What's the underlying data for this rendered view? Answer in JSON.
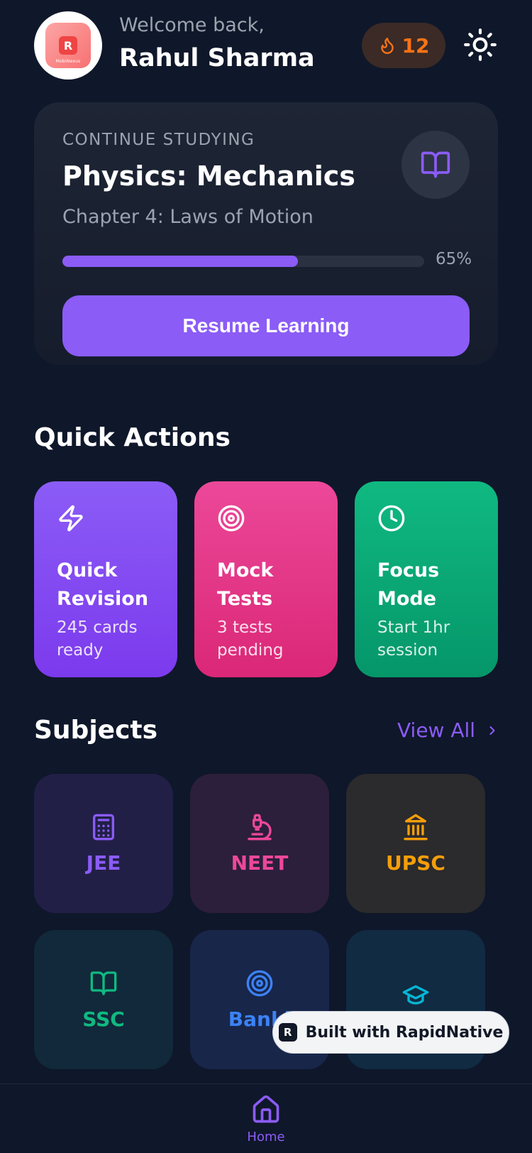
{
  "header": {
    "avatar_caption": "MobiNexus",
    "welcome": "Welcome back,",
    "name": "Rahul Sharma",
    "streak_count": "12",
    "streak_icon": "flame-icon",
    "theme_icon": "sun-icon"
  },
  "continue": {
    "kicker": "CONTINUE STUDYING",
    "title": "Physics: Mechanics",
    "chapter": "Chapter 4: Laws of Motion",
    "progress": 65,
    "progress_label": "65%",
    "button": "Resume Learning",
    "icon": "book-open-icon"
  },
  "quick_actions": {
    "title": "Quick Actions",
    "items": [
      {
        "label": "Quick Revision",
        "desc": "245 cards ready",
        "icon": "zap-icon",
        "color": "#8b5cf6"
      },
      {
        "label": "Mock Tests",
        "desc": "3 tests pending",
        "icon": "target-icon",
        "color": "#ec4899"
      },
      {
        "label": "Focus Mode",
        "desc": "Start 1hr session",
        "icon": "clock-icon",
        "color": "#10b981"
      }
    ]
  },
  "subjects": {
    "title": "Subjects",
    "view_all": "View All",
    "items": [
      {
        "label": "JEE",
        "icon": "calculator-icon",
        "color": "#8b5cf6"
      },
      {
        "label": "NEET",
        "icon": "microscope-icon",
        "color": "#ec4899"
      },
      {
        "label": "UPSC",
        "icon": "landmark-icon",
        "color": "#f59e0b"
      },
      {
        "label": "SSC",
        "icon": "book-open-icon",
        "color": "#10b981"
      },
      {
        "label": "Banki",
        "icon": "target-icon",
        "color": "#3b82f6"
      },
      {
        "label": "",
        "icon": "graduation-cap-icon",
        "color": "#06b6d4"
      }
    ]
  },
  "badge": {
    "text": "Built with RapidNative"
  },
  "tabbar": {
    "home_label": "Home",
    "home_icon": "home-icon"
  },
  "colors": {
    "background": "#0f172a",
    "accent": "#8b5cf6",
    "streak": "#f97316"
  }
}
